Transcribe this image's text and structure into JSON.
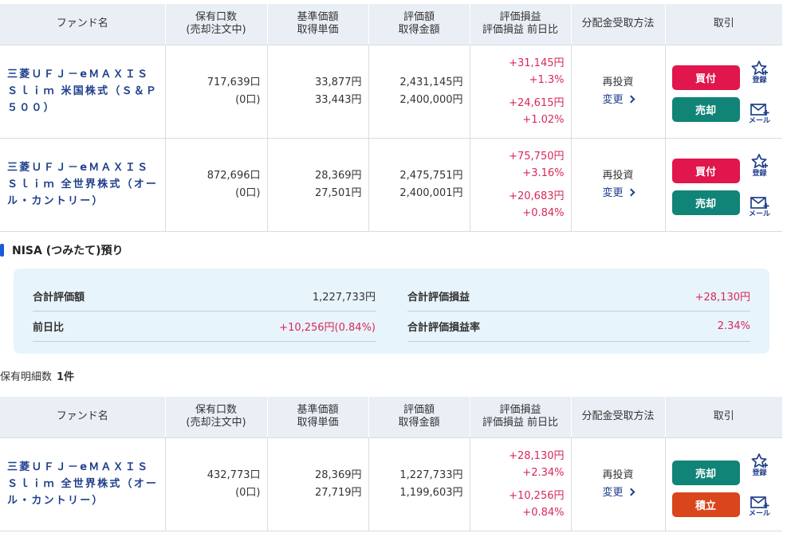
{
  "columns": [
    "ファンド名",
    "保有口数\n(売却注文中)",
    "基準価額\n取得単価",
    "評価額\n取得金額",
    "評価損益\n評価損益 前日比",
    "分配金受取方法",
    "取引"
  ],
  "col_lines": {
    "fund": "ファンド名",
    "units_1": "保有口数",
    "units_2": "(売却注文中)",
    "price_1": "基準価額",
    "price_2": "取得単価",
    "value_1": "評価額",
    "value_2": "取得金額",
    "pl_1": "評価損益",
    "pl_2": "評価損益 前日比",
    "dist": "分配金受取方法",
    "trade": "取引"
  },
  "buttons": {
    "buy": "買付",
    "sell": "売却",
    "accum": "積立",
    "register": "登録",
    "mail": "メール",
    "change": "変更",
    "reinvest": "再投資"
  },
  "tokutei_rows": [
    {
      "name": "三菱ＵＦＪ－eＭＡＸＩＳ Ｓｌｉｍ 米国株式（Ｓ＆Ｐ５００）",
      "name_lines": [
        "三菱ＵＦＪ－eＭＡＸＩＳ",
        "Ｓｌｉｍ 米国株式（Ｓ＆Ｐ",
        "５００）"
      ],
      "units": "717,639口",
      "pending": "(0口)",
      "nav": "33,877円",
      "cost_price": "33,443円",
      "value": "2,431,145円",
      "cost": "2,400,000円",
      "pl": "+31,145円",
      "pl_pct": "+1.3%",
      "day": "+24,615円",
      "day_pct": "+1.02%"
    },
    {
      "name": "三菱ＵＦＪ－eＭＡＸＩＳ Ｓｌｉｍ 全世界株式（オール・カントリー）",
      "name_lines": [
        "三菱ＵＦＪ－eＭＡＸＩＳ",
        "Ｓｌｉｍ 全世界株式（オー",
        "ル・カントリー）"
      ],
      "units": "872,696口",
      "pending": "(0口)",
      "nav": "28,369円",
      "cost_price": "27,501円",
      "value": "2,475,751円",
      "cost": "2,400,001円",
      "pl": "+75,750円",
      "pl_pct": "+3.16%",
      "day": "+20,683円",
      "day_pct": "+0.84%"
    }
  ],
  "nisa": {
    "title": "NISA (つみたて)預り",
    "total_value_label": "合計評価額",
    "total_value": "1,227,733円",
    "total_pl_label": "合計評価損益",
    "total_pl": "+28,130円",
    "day_label": "前日比",
    "day": "+10,256円(0.84%)",
    "pl_rate_label": "合計評価損益率",
    "pl_rate": "2.34%",
    "count_label": "保有明細数",
    "count": "1件",
    "row": {
      "name_lines": [
        "三菱ＵＦＪ－eＭＡＸＩＳ",
        "Ｓｌｉｍ 全世界株式（オー",
        "ル・カントリー）"
      ],
      "units": "432,773口",
      "pending": "(0口)",
      "nav": "28,369円",
      "cost_price": "27,719円",
      "value": "1,227,733円",
      "cost": "1,199,603円",
      "pl": "+28,130円",
      "pl_pct": "+2.34%",
      "day": "+10,256円",
      "day_pct": "+0.84%"
    }
  },
  "colors": {
    "accent_red": "#d8285a",
    "buy": "#e0164d",
    "sell": "#108477",
    "accum": "#d9451c",
    "navy": "#1f3f8c"
  }
}
